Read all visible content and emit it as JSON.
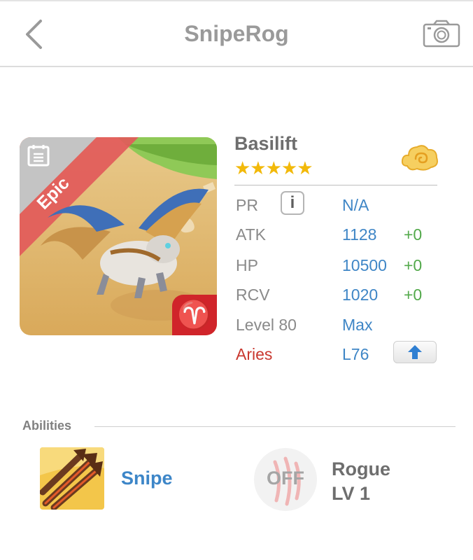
{
  "header": {
    "title": "SnipeRog",
    "back_icon": "chevron-left-icon",
    "camera_icon": "camera-icon"
  },
  "monster": {
    "name": "Basilift",
    "stars": "★★★★★",
    "rarity": "Epic",
    "sign_glyph": "♈",
    "element_icon": "cloud-icon",
    "stats": {
      "pr_label": "PR",
      "pr_info": "i",
      "pr_value": "N/A",
      "atk_label": "ATK",
      "atk_value": "1128",
      "atk_plus": "+0",
      "hp_label": "HP",
      "hp_value": "10500",
      "hp_plus": "+0",
      "rcv_label": "RCV",
      "rcv_value": "1020",
      "rcv_plus": "+0",
      "level_label": "Level 80",
      "level_value": "Max",
      "sign_label": "Aries",
      "sign_value": "L76"
    }
  },
  "abilities": {
    "label": "Abilities",
    "primary": {
      "name": "Snipe",
      "icon": "arrows-icon"
    },
    "secondary": {
      "state": "OFF",
      "name": "Rogue",
      "level": "LV 1",
      "icon": "claw-icon"
    }
  },
  "colors": {
    "accent": "#3f86c6",
    "bonus": "#53a94b",
    "sign": "#c9382f",
    "star": "#f2b90a",
    "rarity": "#e25a5a"
  }
}
